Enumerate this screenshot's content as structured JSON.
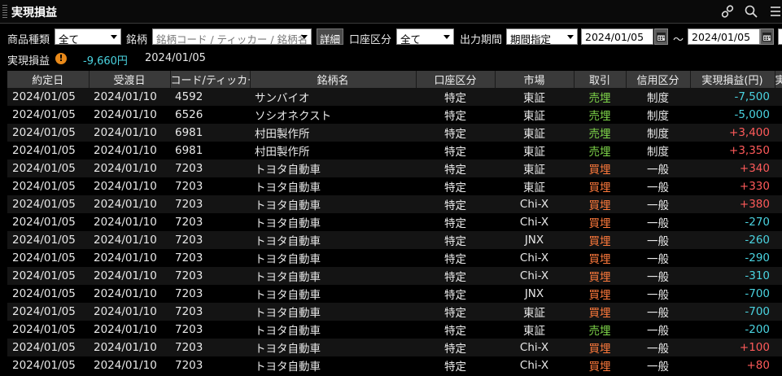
{
  "window": {
    "title": "実現損益"
  },
  "filters": {
    "product_type_label": "商品種類",
    "product_type_value": "全て",
    "symbol_label": "銘柄",
    "symbol_placeholder": "銘柄コード / ティッカー / 銘柄名",
    "detail_button": "詳細",
    "account_label": "口座区分",
    "account_value": "全て",
    "period_label": "出力期間",
    "period_value": "期間指定",
    "date_from": "2024/01/05",
    "date_sep": "～",
    "date_to": "2024/01/05"
  },
  "summary": {
    "label": "実現損益",
    "warn_icon": "!",
    "amount": "-9,660円",
    "date": "2024/01/05"
  },
  "colors": {
    "sell": "#7fd64a",
    "buy": "#ff7a3c",
    "positive": "#ff5a5a",
    "negative": "#4ad3e0"
  },
  "table": {
    "headers": [
      "約定日",
      "受渡日",
      "コード/ティッカー",
      "銘柄名",
      "口座区分",
      "市場",
      "取引",
      "信用区分",
      "実現損益(円)",
      "実現損"
    ],
    "rows": [
      [
        "2024/01/05",
        "2024/01/10",
        "4592",
        "サンバイオ",
        "特定",
        "東証",
        "売埋",
        "制度",
        "-7,500"
      ],
      [
        "2024/01/05",
        "2024/01/10",
        "6526",
        "ソシオネクスト",
        "特定",
        "東証",
        "売埋",
        "制度",
        "-5,000"
      ],
      [
        "2024/01/05",
        "2024/01/10",
        "6981",
        "村田製作所",
        "特定",
        "東証",
        "売埋",
        "制度",
        "+3,400"
      ],
      [
        "2024/01/05",
        "2024/01/10",
        "6981",
        "村田製作所",
        "特定",
        "東証",
        "売埋",
        "制度",
        "+3,350"
      ],
      [
        "2024/01/05",
        "2024/01/10",
        "7203",
        "トヨタ自動車",
        "特定",
        "東証",
        "買埋",
        "一般",
        "+340"
      ],
      [
        "2024/01/05",
        "2024/01/10",
        "7203",
        "トヨタ自動車",
        "特定",
        "東証",
        "買埋",
        "一般",
        "+330"
      ],
      [
        "2024/01/05",
        "2024/01/10",
        "7203",
        "トヨタ自動車",
        "特定",
        "Chi-X",
        "買埋",
        "一般",
        "+380"
      ],
      [
        "2024/01/05",
        "2024/01/10",
        "7203",
        "トヨタ自動車",
        "特定",
        "Chi-X",
        "買埋",
        "一般",
        "-270"
      ],
      [
        "2024/01/05",
        "2024/01/10",
        "7203",
        "トヨタ自動車",
        "特定",
        "JNX",
        "買埋",
        "一般",
        "-260"
      ],
      [
        "2024/01/05",
        "2024/01/10",
        "7203",
        "トヨタ自動車",
        "特定",
        "Chi-X",
        "買埋",
        "一般",
        "-290"
      ],
      [
        "2024/01/05",
        "2024/01/10",
        "7203",
        "トヨタ自動車",
        "特定",
        "Chi-X",
        "買埋",
        "一般",
        "-310"
      ],
      [
        "2024/01/05",
        "2024/01/10",
        "7203",
        "トヨタ自動車",
        "特定",
        "JNX",
        "買埋",
        "一般",
        "-700"
      ],
      [
        "2024/01/05",
        "2024/01/10",
        "7203",
        "トヨタ自動車",
        "特定",
        "東証",
        "買埋",
        "一般",
        "-700"
      ],
      [
        "2024/01/05",
        "2024/01/10",
        "7203",
        "トヨタ自動車",
        "特定",
        "東証",
        "売埋",
        "一般",
        "-200"
      ],
      [
        "2024/01/05",
        "2024/01/10",
        "7203",
        "トヨタ自動車",
        "特定",
        "Chi-X",
        "買埋",
        "一般",
        "+100"
      ],
      [
        "2024/01/05",
        "2024/01/10",
        "7203",
        "トヨタ自動車",
        "特定",
        "Chi-X",
        "買埋",
        "一般",
        "+80"
      ]
    ]
  }
}
